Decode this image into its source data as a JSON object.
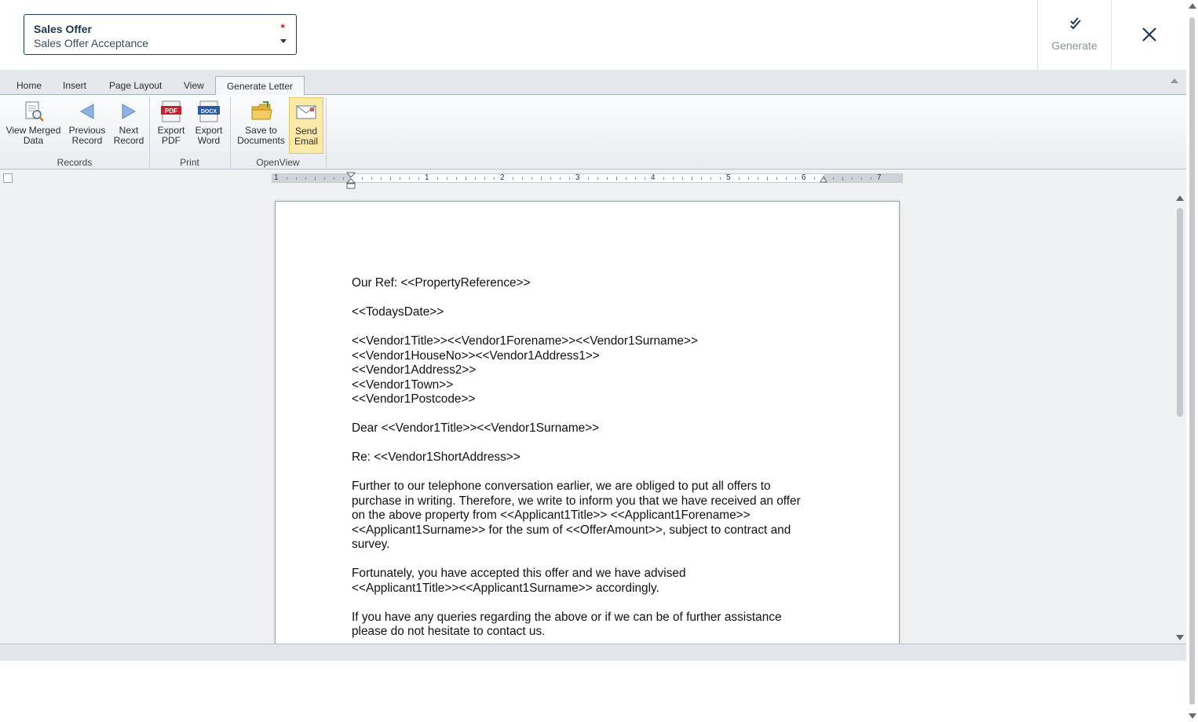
{
  "header": {
    "select_label": "Sales Offer",
    "select_value": "Sales Offer Acceptance",
    "required_marker": "*",
    "generate_label": "Generate"
  },
  "ribbon": {
    "tabs": [
      "Home",
      "Insert",
      "Page Layout",
      "View",
      "Generate Letter"
    ],
    "active_tab": "Generate Letter",
    "buttons": {
      "view_merged_1": "View Merged",
      "view_merged_2": "Data",
      "previous_1": "Previous",
      "previous_2": "Record",
      "next_1": "Next",
      "next_2": "Record",
      "export_pdf_1": "Export",
      "export_pdf_2": "PDF",
      "export_word_1": "Export",
      "export_word_2": "Word",
      "save_docs_1": "Save to",
      "save_docs_2": "Documents",
      "send_email_1": "Send",
      "send_email_2": "Email"
    },
    "groups": {
      "records": "Records",
      "print": "Print",
      "openview": "OpenView"
    },
    "icon_text": {
      "pdf": "PDF",
      "docx": "DOCX"
    }
  },
  "ruler": {
    "labels": [
      "1",
      "1",
      "2",
      "3",
      "4",
      "5",
      "6",
      "7"
    ]
  },
  "letter": {
    "our_ref": "Our Ref: <<PropertyReference>>",
    "date": "<<TodaysDate>>",
    "address_line1": "<<Vendor1Title>><<Vendor1Forename>><<Vendor1Surname>>",
    "address_line2": "<<Vendor1HouseNo>><<Vendor1Address1>>",
    "address_line3": "<<Vendor1Address2>>",
    "address_line4": "<<Vendor1Town>>",
    "address_line5": "<<Vendor1Postcode>>",
    "salutation": "Dear <<Vendor1Title>><<Vendor1Surname>>",
    "re_line": "Re: <<Vendor1ShortAddress>>",
    "para1_l1": "Further to our telephone conversation earlier, we are obliged to put all offers to",
    "para1_l2": "purchase in writing. Therefore, we write to inform you that we have received an offer",
    "para1_l3": "on the above property from <<Applicant1Title>> <<Applicant1Forename>>",
    "para1_l4": "<<Applicant1Surname>> for the sum of <<OfferAmount>>, subject to contract and",
    "para1_l5": "survey.",
    "para2_l1": "Fortunately, you have accepted this offer and we have advised",
    "para2_l2": "<<Applicant1Title>><<Applicant1Surname>> accordingly.",
    "para3_l1": "If you have any queries regarding the above or if we can be of further assistance",
    "para3_l2": "please do not hesitate to contact us."
  },
  "icons": [
    "check-double-icon",
    "close-icon",
    "chevron-down-icon",
    "magnifier-document-icon",
    "arrow-left-icon",
    "arrow-right-icon",
    "pdf-file-icon",
    "docx-file-icon",
    "folder-icon",
    "email-icon"
  ],
  "colors": {
    "brand_dark": "#1e3650",
    "required": "#c0282d",
    "active_button": "#fbe9a8"
  }
}
